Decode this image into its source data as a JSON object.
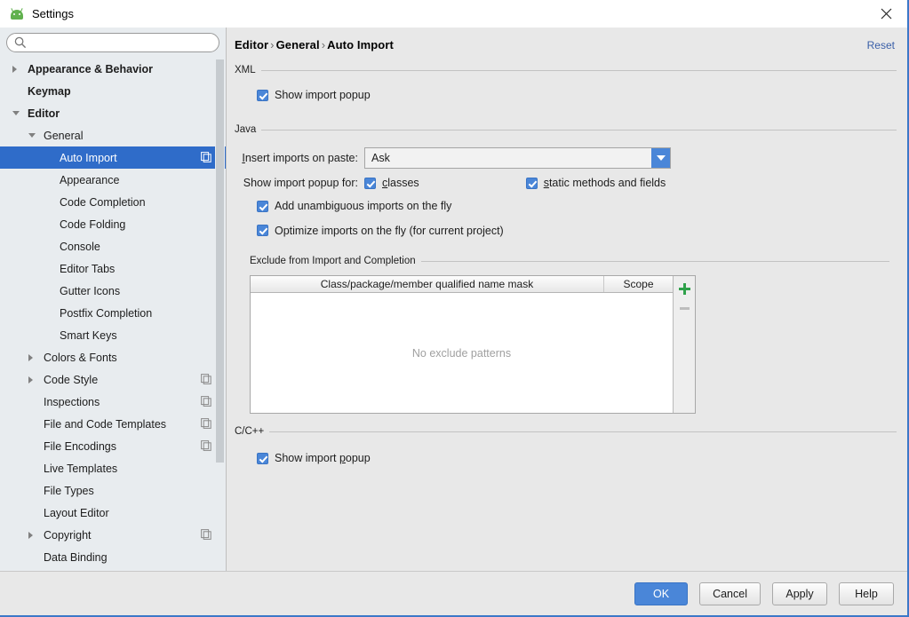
{
  "window": {
    "title": "Settings",
    "app_icon": "android-head-icon",
    "close_icon": "close-icon"
  },
  "search": {
    "value": "",
    "placeholder": "",
    "icon": "search-icon"
  },
  "sidebar": {
    "items": [
      {
        "label": "Appearance & Behavior",
        "indent": 0,
        "arrow": "collapsed",
        "bold": true,
        "copy_icon": false,
        "selected": false
      },
      {
        "label": "Keymap",
        "indent": 0,
        "arrow": "none",
        "bold": true,
        "copy_icon": false,
        "selected": false
      },
      {
        "label": "Editor",
        "indent": 0,
        "arrow": "expanded",
        "bold": true,
        "copy_icon": false,
        "selected": false
      },
      {
        "label": "General",
        "indent": 1,
        "arrow": "expanded",
        "bold": false,
        "copy_icon": false,
        "selected": false
      },
      {
        "label": "Auto Import",
        "indent": 2,
        "arrow": "none",
        "bold": false,
        "copy_icon": true,
        "selected": true
      },
      {
        "label": "Appearance",
        "indent": 2,
        "arrow": "none",
        "bold": false,
        "copy_icon": false,
        "selected": false
      },
      {
        "label": "Code Completion",
        "indent": 2,
        "arrow": "none",
        "bold": false,
        "copy_icon": false,
        "selected": false
      },
      {
        "label": "Code Folding",
        "indent": 2,
        "arrow": "none",
        "bold": false,
        "copy_icon": false,
        "selected": false
      },
      {
        "label": "Console",
        "indent": 2,
        "arrow": "none",
        "bold": false,
        "copy_icon": false,
        "selected": false
      },
      {
        "label": "Editor Tabs",
        "indent": 2,
        "arrow": "none",
        "bold": false,
        "copy_icon": false,
        "selected": false
      },
      {
        "label": "Gutter Icons",
        "indent": 2,
        "arrow": "none",
        "bold": false,
        "copy_icon": false,
        "selected": false
      },
      {
        "label": "Postfix Completion",
        "indent": 2,
        "arrow": "none",
        "bold": false,
        "copy_icon": false,
        "selected": false
      },
      {
        "label": "Smart Keys",
        "indent": 2,
        "arrow": "none",
        "bold": false,
        "copy_icon": false,
        "selected": false
      },
      {
        "label": "Colors & Fonts",
        "indent": 1,
        "arrow": "collapsed",
        "bold": false,
        "copy_icon": false,
        "selected": false
      },
      {
        "label": "Code Style",
        "indent": 1,
        "arrow": "collapsed",
        "bold": false,
        "copy_icon": true,
        "selected": false
      },
      {
        "label": "Inspections",
        "indent": 1,
        "arrow": "none",
        "bold": false,
        "copy_icon": true,
        "selected": false
      },
      {
        "label": "File and Code Templates",
        "indent": 1,
        "arrow": "none",
        "bold": false,
        "copy_icon": true,
        "selected": false
      },
      {
        "label": "File Encodings",
        "indent": 1,
        "arrow": "none",
        "bold": false,
        "copy_icon": true,
        "selected": false
      },
      {
        "label": "Live Templates",
        "indent": 1,
        "arrow": "none",
        "bold": false,
        "copy_icon": false,
        "selected": false
      },
      {
        "label": "File Types",
        "indent": 1,
        "arrow": "none",
        "bold": false,
        "copy_icon": false,
        "selected": false
      },
      {
        "label": "Layout Editor",
        "indent": 1,
        "arrow": "none",
        "bold": false,
        "copy_icon": false,
        "selected": false
      },
      {
        "label": "Copyright",
        "indent": 1,
        "arrow": "collapsed",
        "bold": false,
        "copy_icon": true,
        "selected": false
      },
      {
        "label": "Data Binding",
        "indent": 1,
        "arrow": "none",
        "bold": false,
        "copy_icon": false,
        "selected": false
      }
    ]
  },
  "content": {
    "breadcrumb": {
      "part1": "Editor",
      "part2": "General",
      "part3": "Auto Import",
      "separator": "›"
    },
    "reset_label": "Reset",
    "xml": {
      "title": "XML",
      "show_import_popup": {
        "label": "Show import popup",
        "checked": true
      }
    },
    "java": {
      "title": "Java",
      "insert_imports_label": "Insert imports on paste:",
      "insert_imports_value": "Ask",
      "show_import_popup_for_label": "Show import popup for:",
      "classes": {
        "label": "classes",
        "checked": true
      },
      "static_methods": {
        "label": "static methods and fields",
        "checked": true
      },
      "add_unambiguous": {
        "label": "Add unambiguous imports on the fly",
        "checked": true
      },
      "optimize_imports": {
        "label": "Optimize imports on the fly (for current project)",
        "checked": true
      }
    },
    "exclude": {
      "title": "Exclude from Import and Completion",
      "columns": [
        "Class/package/member qualified name mask",
        "Scope"
      ],
      "rows": [],
      "empty_text": "No exclude patterns",
      "add_button": "add-pattern-button",
      "remove_button": "remove-pattern-button"
    },
    "cpp": {
      "title": "C/C++",
      "show_import_popup": {
        "label": "Show import popup",
        "checked": true
      }
    }
  },
  "footer": {
    "ok": "OK",
    "cancel": "Cancel",
    "apply": "Apply",
    "help": "Help"
  },
  "colors": {
    "accent": "#4a86d8",
    "selection": "#2f6cc9",
    "link": "#3a5fa8",
    "window_bg": "#e8e8e8",
    "sidebar_bg": "#e8ecef",
    "add_green": "#2fa14b",
    "border_blue": "#3c78c8"
  }
}
